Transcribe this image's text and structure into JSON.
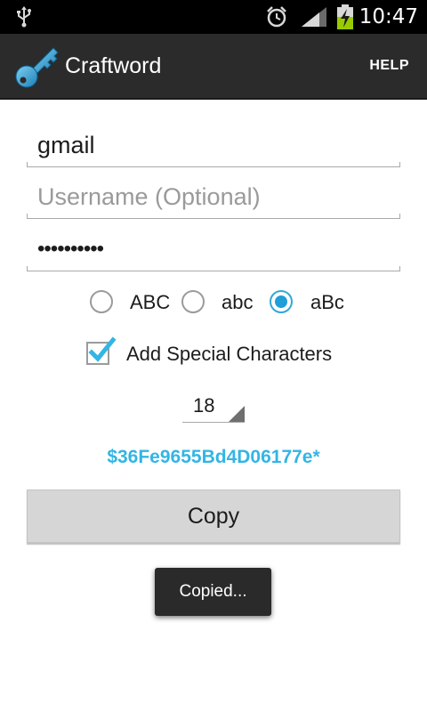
{
  "status_bar": {
    "icons": [
      "usb-icon",
      "alarm-icon",
      "signal-icon",
      "battery-charging-icon"
    ],
    "time": "10:47"
  },
  "action_bar": {
    "app_icon": "key-icon",
    "title": "Craftword",
    "help_label": "HELP"
  },
  "form": {
    "site": {
      "value": "gmail"
    },
    "username": {
      "value": "",
      "placeholder": "Username (Optional)"
    },
    "password": {
      "value": "••••••••••"
    },
    "case_options": [
      {
        "label": "ABC",
        "checked": false
      },
      {
        "label": "abc",
        "checked": false
      },
      {
        "label": "aBc",
        "checked": true
      }
    ],
    "special_chars": {
      "label": "Add Special Characters",
      "checked": true
    },
    "length": "18",
    "generated_password": "$36Fe9655Bd4D06177e*",
    "copy_label": "Copy"
  },
  "toast": {
    "text": "Copied..."
  },
  "colors": {
    "accent": "#33b5e5",
    "action_bar": "#2b2b2b",
    "status_bar": "#000000",
    "button": "#d6d6d6"
  }
}
